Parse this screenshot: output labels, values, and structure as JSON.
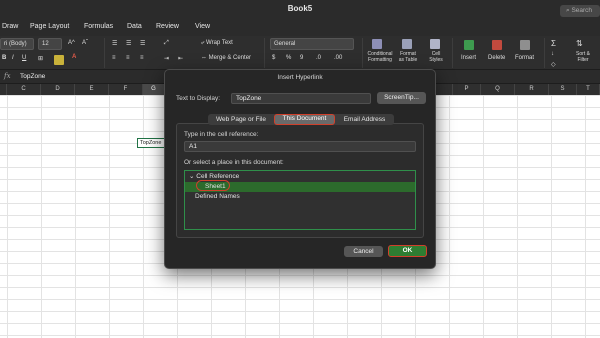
{
  "window": {
    "title": "Book5",
    "search": "Search"
  },
  "menu": [
    "Draw",
    "Page Layout",
    "Formulas",
    "Data",
    "Review",
    "View"
  ],
  "ribbon": {
    "font_name": "ri (Body)",
    "font_size": "12",
    "wrap_text": "Wrap Text",
    "merge_center": "Merge & Center",
    "number_format": "General",
    "conditional_formatting": [
      "Conditional",
      "Formatting"
    ],
    "format_as_table": [
      "Format",
      "as Table"
    ],
    "cell_styles": [
      "Cell",
      "Styles"
    ],
    "insert": "Insert",
    "delete": "Delete",
    "format": "Format",
    "sort_filter": [
      "Sort &",
      "Filter"
    ],
    "bold": "B"
  },
  "formula_bar": {
    "fx": "fx",
    "value": "TopZone"
  },
  "columns": [
    "C",
    "D",
    "E",
    "F",
    "G",
    "P",
    "Q",
    "R",
    "S",
    "T"
  ],
  "selected_column": "G",
  "active_cell_text": "TopZone",
  "dialog": {
    "title": "Insert Hyperlink",
    "text_to_display_label": "Text to Display:",
    "text_to_display_value": "TopZone",
    "screentip_button": "ScreenTip...",
    "tabs": [
      "Web Page or File",
      "This Document",
      "Email Address"
    ],
    "active_tab": "This Document",
    "cell_ref_label": "Type in the cell reference:",
    "cell_ref_value": "A1",
    "place_label": "Or select a place in this document:",
    "tree": {
      "group": "Cell Reference",
      "selected_item": "Sheet1",
      "other_group": "Defined Names"
    },
    "cancel_button": "Cancel",
    "ok_button": "OK"
  },
  "colors": {
    "accent_green": "#2e7d32",
    "highlight_red": "#d0402b",
    "excel_green": "#217346"
  }
}
